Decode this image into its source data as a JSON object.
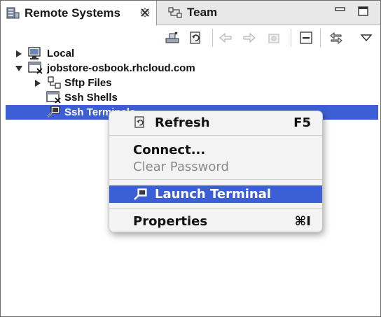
{
  "tabs": [
    {
      "label": "Remote Systems",
      "icon": "remote-systems-icon",
      "active": true
    },
    {
      "label": "Team",
      "icon": "team-icon",
      "active": false
    }
  ],
  "toolbar": {
    "icons": [
      "new-connection-icon",
      "refresh-view-icon",
      "back-arrow-icon",
      "forward-arrow-icon",
      "home-icon",
      "collapse-all-icon",
      "link-with-editor-icon",
      "view-menu-icon"
    ]
  },
  "tree": [
    {
      "label": "Local",
      "expanded": false,
      "icon": "local-system-icon"
    },
    {
      "label": "jobstore-osbook.rhcloud.com",
      "expanded": true,
      "icon": "remote-host-icon"
    },
    {
      "label": "Sftp Files",
      "expanded": false,
      "icon": "sftp-files-icon"
    },
    {
      "label": "Ssh Shells",
      "icon": "ssh-shells-icon"
    },
    {
      "label": "Ssh Terminals",
      "icon": "ssh-terminals-icon",
      "selected": true
    }
  ],
  "context_menu": {
    "items": [
      {
        "label": "Refresh",
        "shortcut": "F5",
        "icon": "refresh-icon"
      },
      {
        "label": "Connect..."
      },
      {
        "label": "Clear Password",
        "disabled": true
      },
      {
        "label": "Launch Terminal",
        "icon": "terminal-icon",
        "highlighted": true
      },
      {
        "label": "Properties",
        "shortcut": "⌘I"
      }
    ]
  },
  "colors": {
    "selection": "#3d5fd6",
    "menu_background": "#f3f3f3",
    "tab_bar": "#e8e8e8",
    "disabled_text": "#8a8a8a"
  }
}
